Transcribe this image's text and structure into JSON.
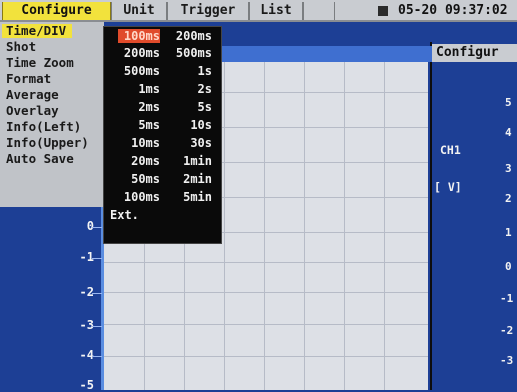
{
  "menubar": {
    "tabs": [
      {
        "label": "Configure",
        "active": true
      },
      {
        "label": "Unit",
        "active": false
      },
      {
        "label": "Trigger",
        "active": false
      },
      {
        "label": "List",
        "active": false
      },
      {
        "label": "",
        "active": false
      }
    ],
    "datetime": "05-20 09:37:02"
  },
  "menu": {
    "items": [
      {
        "label": "Time/DIV",
        "selected": true
      },
      {
        "label": "Shot",
        "selected": false
      },
      {
        "label": "Time Zoom",
        "selected": false
      },
      {
        "label": "Format",
        "selected": false
      },
      {
        "label": "Average",
        "selected": false
      },
      {
        "label": "Overlay",
        "selected": false
      },
      {
        "label": "Info(Left)",
        "selected": false
      },
      {
        "label": "Info(Upper)",
        "selected": false
      },
      {
        "label": "Auto Save",
        "selected": false
      }
    ]
  },
  "timediv": {
    "options": [
      [
        "100ms",
        "200ms"
      ],
      [
        "200ms",
        "500ms"
      ],
      [
        "500ms",
        "1s"
      ],
      [
        "1ms",
        "2s"
      ],
      [
        "2ms",
        "5s"
      ],
      [
        "5ms",
        "10s"
      ],
      [
        "10ms",
        "30s"
      ],
      [
        "20ms",
        "1min"
      ],
      [
        "50ms",
        "2min"
      ],
      [
        "100ms",
        "5min"
      ],
      [
        "Ext.",
        ""
      ]
    ],
    "highlighted": "100ms"
  },
  "graph": {
    "y_labels": [
      "0",
      "-1",
      "-2",
      "-3",
      "-4",
      "-5"
    ]
  },
  "right_panel": {
    "title": "Configur",
    "channel": "CH1",
    "unit": "[ V]",
    "scale": [
      "5",
      "4",
      "3",
      "2",
      "1",
      "0",
      "-1",
      "-2",
      "-3"
    ]
  },
  "colors": {
    "menu_highlight": "#f2e23c",
    "option_highlight": "#e04b2b",
    "background": "#1d3f95",
    "graph_bg": "#dde0e6"
  }
}
